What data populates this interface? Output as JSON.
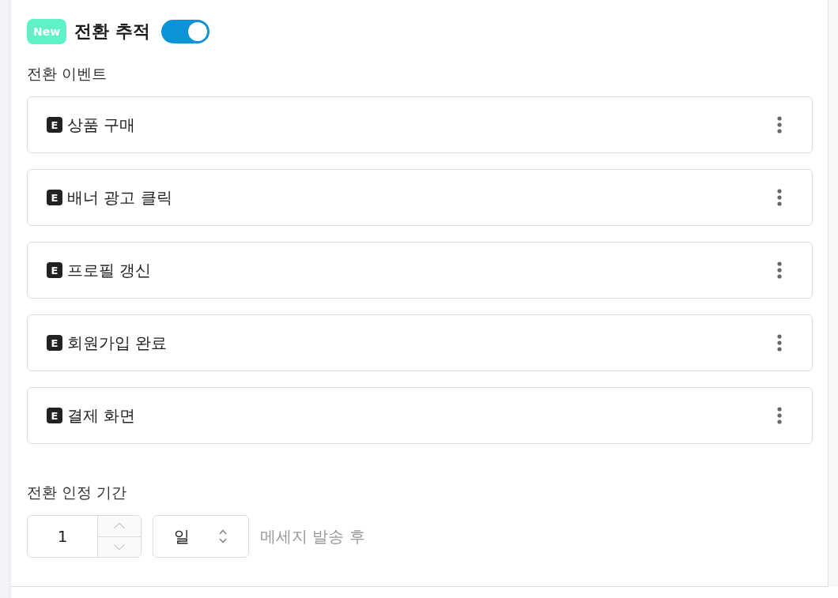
{
  "header": {
    "badge": "New",
    "title": "전환 추적",
    "tracking_on": true
  },
  "events": {
    "label": "전환 이벤트",
    "items": [
      {
        "badge": "E",
        "name": "상품 구매"
      },
      {
        "badge": "E",
        "name": "배너 광고 클릭"
      },
      {
        "badge": "E",
        "name": "프로필 갱신"
      },
      {
        "badge": "E",
        "name": "회원가입 완료"
      },
      {
        "badge": "E",
        "name": "결제 화면"
      }
    ]
  },
  "attribution_window": {
    "label": "전환 인정 기간",
    "value": "1",
    "unit": "일",
    "suffix": "메세지 발송 후"
  }
}
